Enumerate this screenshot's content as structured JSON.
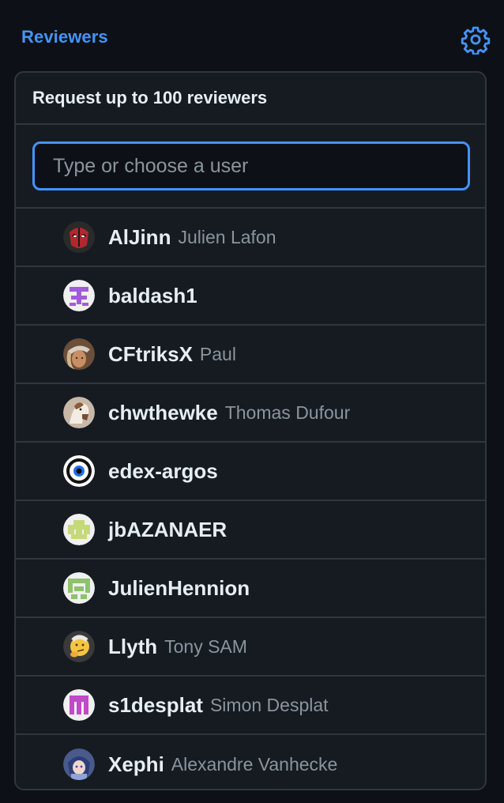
{
  "header": {
    "title": "Reviewers",
    "settings_icon": "gear-icon"
  },
  "panel": {
    "title": "Request up to 100 reviewers",
    "filter_placeholder": "Type or choose a user",
    "filter_value": ""
  },
  "users": [
    {
      "login": "AlJinn",
      "name": "Julien Lafon",
      "avatar": "avatar-deadpool"
    },
    {
      "login": "baldash1",
      "name": "",
      "avatar": "avatar-identicon-purple"
    },
    {
      "login": "CFtriksX",
      "name": "Paul",
      "avatar": "avatar-photo"
    },
    {
      "login": "chwthewke",
      "name": "Thomas Dufour",
      "avatar": "avatar-photo"
    },
    {
      "login": "edex-argos",
      "name": "",
      "avatar": "avatar-eye"
    },
    {
      "login": "jbAZANAER",
      "name": "",
      "avatar": "avatar-identicon-lime"
    },
    {
      "login": "JulienHennion",
      "name": "",
      "avatar": "avatar-identicon-green"
    },
    {
      "login": "Llyth",
      "name": "Tony SAM",
      "avatar": "avatar-thinking-emoji"
    },
    {
      "login": "s1desplat",
      "name": "Simon Desplat",
      "avatar": "avatar-identicon-magenta"
    },
    {
      "login": "Xephi",
      "name": "Alexandre Vanhecke",
      "avatar": "avatar-anime"
    }
  ],
  "colors": {
    "accent": "#4493f8",
    "background": "#0d1117",
    "panel": "#161b22",
    "border": "#30363d",
    "text": "#e6edf3",
    "muted": "#8b949e"
  }
}
